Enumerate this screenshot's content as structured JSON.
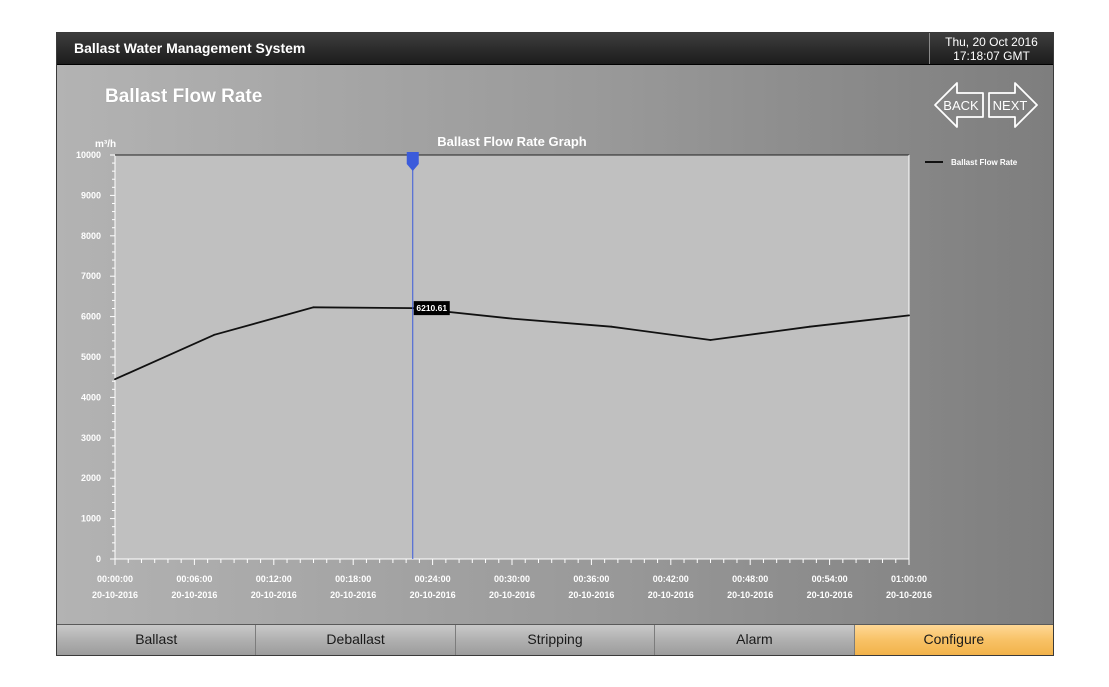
{
  "header": {
    "app_title": "Ballast Water Management System",
    "date": "Thu, 20 Oct 2016",
    "time": "17:18:07 GMT"
  },
  "page": {
    "title": "Ballast Flow Rate",
    "back_label": "BACK",
    "next_label": "NEXT"
  },
  "tabs": [
    {
      "label": "Ballast",
      "active": false
    },
    {
      "label": "Deballast",
      "active": false
    },
    {
      "label": "Stripping",
      "active": false
    },
    {
      "label": "Alarm",
      "active": false
    },
    {
      "label": "Configure",
      "active": true
    }
  ],
  "chart_data": {
    "type": "line",
    "title": "Ballast Flow Rate Graph",
    "ylabel": "m³/h",
    "xlabel": "",
    "ylim": [
      0,
      10000
    ],
    "yticks": [
      "0",
      "1000",
      "2000",
      "3000",
      "4000",
      "5000",
      "6000",
      "7000",
      "8000",
      "9000",
      "10000"
    ],
    "xlim": [
      "00:00:00",
      "01:00:00"
    ],
    "xticks": [
      {
        "time": "00:00:00",
        "date": "20-10-2016"
      },
      {
        "time": "00:06:00",
        "date": "20-10-2016"
      },
      {
        "time": "00:12:00",
        "date": "20-10-2016"
      },
      {
        "time": "00:18:00",
        "date": "20-10-2016"
      },
      {
        "time": "00:24:00",
        "date": "20-10-2016"
      },
      {
        "time": "00:30:00",
        "date": "20-10-2016"
      },
      {
        "time": "00:36:00",
        "date": "20-10-2016"
      },
      {
        "time": "00:42:00",
        "date": "20-10-2016"
      },
      {
        "time": "00:48:00",
        "date": "20-10-2016"
      },
      {
        "time": "00:54:00",
        "date": "20-10-2016"
      },
      {
        "time": "01:00:00",
        "date": "20-10-2016"
      }
    ],
    "series": [
      {
        "name": "Ballast Flow Rate",
        "color": "#111111",
        "points": [
          {
            "x": "00:00:00",
            "y": 4450
          },
          {
            "x": "00:07:30",
            "y": 5550
          },
          {
            "x": "00:15:00",
            "y": 6230
          },
          {
            "x": "00:22:30",
            "y": 6210
          },
          {
            "x": "00:30:00",
            "y": 5950
          },
          {
            "x": "00:37:30",
            "y": 5750
          },
          {
            "x": "00:45:00",
            "y": 5420
          },
          {
            "x": "00:52:30",
            "y": 5750
          },
          {
            "x": "01:00:00",
            "y": 6030
          }
        ]
      }
    ],
    "cursor": {
      "x": "00:22:30",
      "value_label": "6210.61",
      "color": "#3b5bdb"
    },
    "legend": "right",
    "plot_background": "#c0c0c0",
    "grid": false
  }
}
